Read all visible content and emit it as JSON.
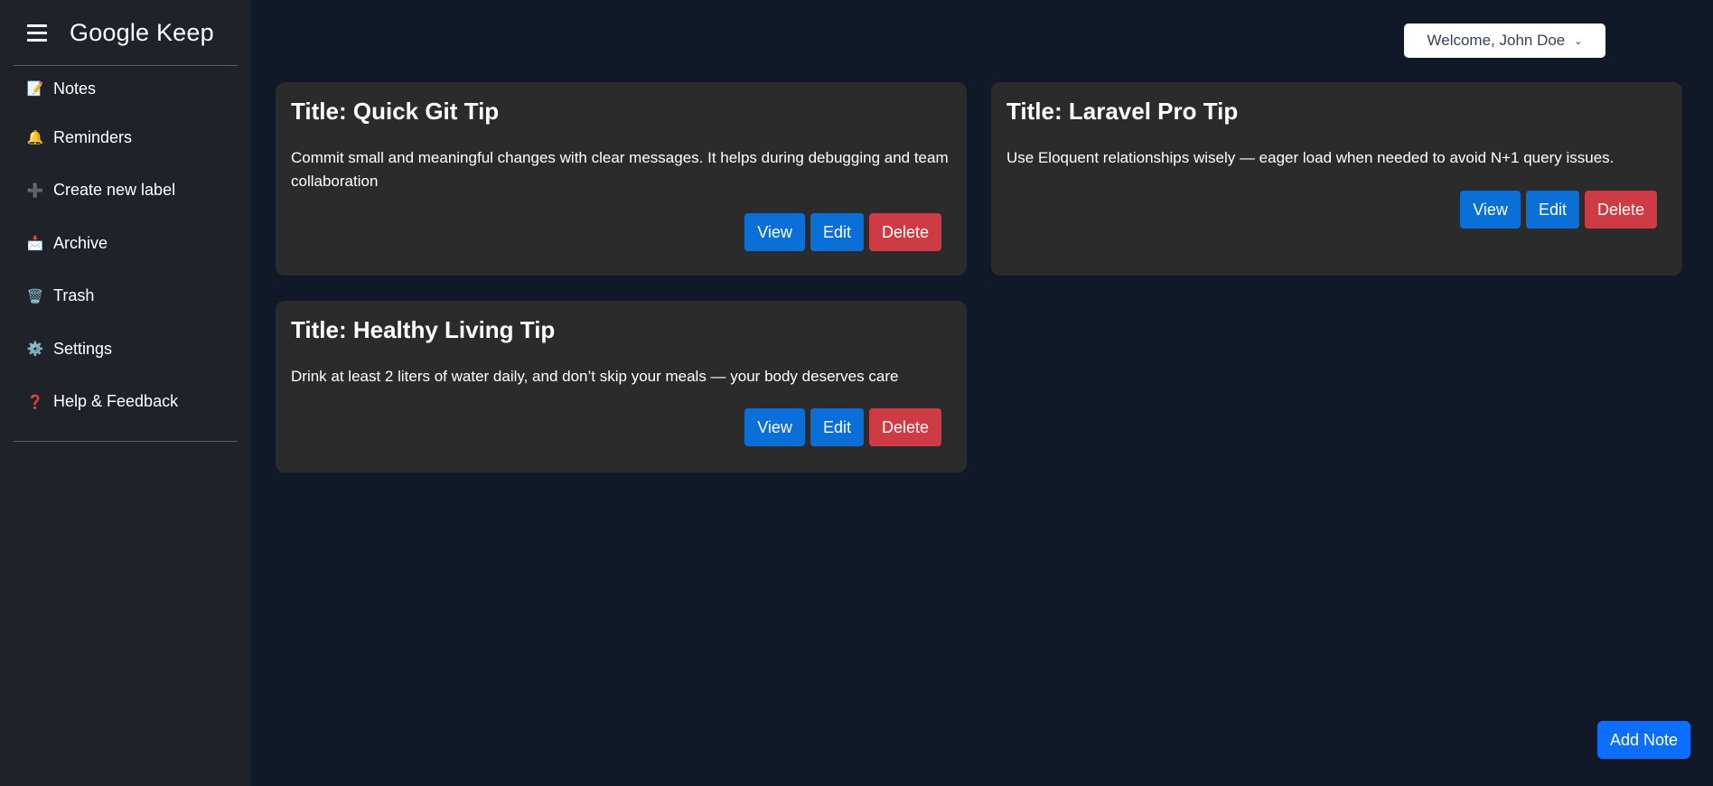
{
  "app": {
    "title": "Google Keep"
  },
  "header": {
    "welcome_label": "Welcome, John Doe"
  },
  "sidebar": {
    "items": [
      {
        "label": "Notes",
        "icon": "📝"
      },
      {
        "label": "Reminders",
        "icon": "🔔"
      },
      {
        "label": "Create new label",
        "icon": "➕"
      },
      {
        "label": "Archive",
        "icon": "📩"
      },
      {
        "label": "Trash",
        "icon": "🗑️"
      },
      {
        "label": "Settings",
        "icon": "⚙️"
      },
      {
        "label": "Help & Feedback",
        "icon": "❓"
      }
    ]
  },
  "notes": [
    {
      "title": "Title: Quick Git Tip",
      "body": "Commit small and meaningful changes with clear messages. It helps during debugging and team collaboration",
      "view_label": "View",
      "edit_label": "Edit",
      "delete_label": "Delete"
    },
    {
      "title": "Title: Laravel Pro Tip",
      "body": "Use Eloquent relationships wisely — eager load when needed to avoid N+1 query issues.",
      "view_label": "View",
      "edit_label": "Edit",
      "delete_label": "Delete"
    },
    {
      "title": "Title: Healthy Living Tip",
      "body": "Drink at least 2 liters of water daily, and don’t skip your meals — your body deserves care",
      "view_label": "View",
      "edit_label": "Edit",
      "delete_label": "Delete"
    }
  ],
  "add_note_label": "Add Note",
  "colors": {
    "background": "#111827",
    "sidebar": "#1f2329",
    "card": "#2b2b2b",
    "primary": "#0b6fd8",
    "danger": "#cf3b45"
  }
}
